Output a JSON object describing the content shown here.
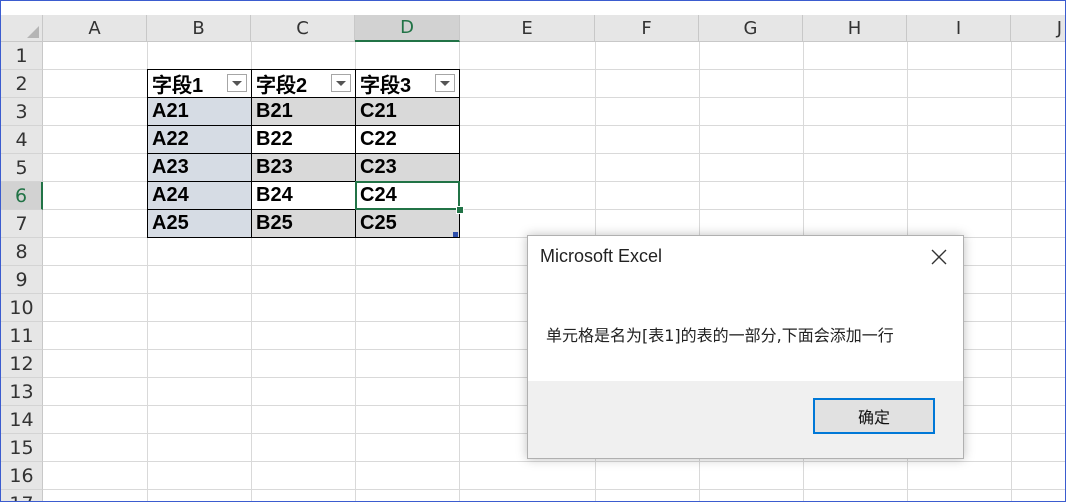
{
  "columns": [
    "A",
    "B",
    "C",
    "D",
    "E",
    "F",
    "G",
    "H",
    "I",
    "J"
  ],
  "rows": [
    "1",
    "2",
    "3",
    "4",
    "5",
    "6",
    "7",
    "8",
    "9",
    "10",
    "11",
    "12",
    "13",
    "14",
    "15",
    "16",
    "17"
  ],
  "selected_column": "D",
  "selected_row": "6",
  "table": {
    "headers": [
      "字段1",
      "字段2",
      "字段3"
    ],
    "rows": [
      [
        "A21",
        "B21",
        "C21"
      ],
      [
        "A22",
        "B22",
        "C22"
      ],
      [
        "A23",
        "B23",
        "C23"
      ],
      [
        "A24",
        "B24",
        "C24"
      ],
      [
        "A25",
        "B25",
        "C25"
      ]
    ]
  },
  "dialog": {
    "title": "Microsoft Excel",
    "message": "单元格是名为[表1]的表的一部分,下面会添加一行",
    "ok_label": "确定"
  },
  "icons": {
    "filter": "filter-dropdown-icon",
    "close": "close-icon"
  },
  "colors": {
    "selection": "#217346",
    "header_band": "#d9d9d9",
    "first_column": "#d6dce4",
    "dialog_button_border": "#0078d7"
  }
}
